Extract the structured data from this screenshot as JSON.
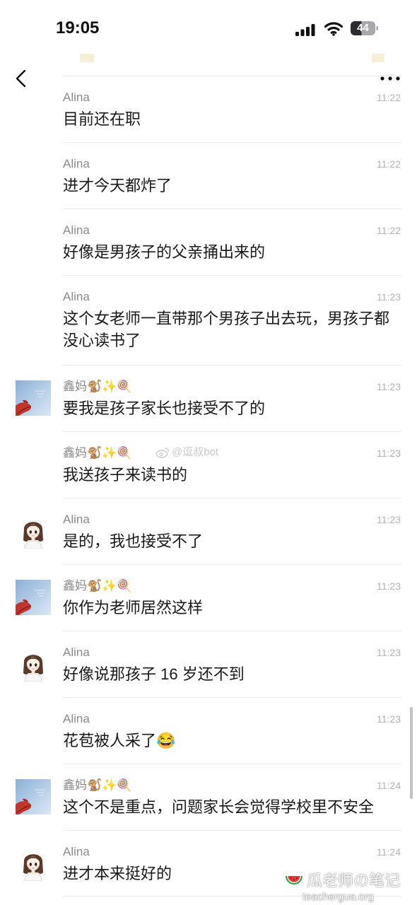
{
  "status_bar": {
    "time": "19:05",
    "battery": "44",
    "icons": [
      "signal-icon",
      "wifi-icon",
      "battery-icon"
    ]
  },
  "nav": {
    "back_icon": "chevron-left-icon",
    "more_icon": "more-icon"
  },
  "messages": [
    {
      "sender": "Alina",
      "time": "11:22",
      "text": "目前还在职",
      "avatar": null
    },
    {
      "sender": "Alina",
      "time": "11:22",
      "text": "进才今天都炸了",
      "avatar": null
    },
    {
      "sender": "Alina",
      "time": "11:22",
      "text": "好像是男孩子的父亲捅出来的",
      "avatar": null
    },
    {
      "sender": "Alina",
      "time": "11:23",
      "text": "这个女老师一直带那个男孩子出去玩，男孩子都没心读书了",
      "avatar": null
    },
    {
      "sender": "鑫妈🐒✨🍭",
      "time": "11:23",
      "text": "要我是孩子家长也接受不了的",
      "avatar": "xinma-avatar"
    },
    {
      "sender": "鑫妈🐒✨🍭",
      "time": "11:23",
      "text": "我送孩子来读书的",
      "avatar": null
    },
    {
      "sender": "Alina",
      "time": "11:23",
      "text": "是的，我也接受不了",
      "avatar": "alina-avatar"
    },
    {
      "sender": "鑫妈🐒✨🍭",
      "time": "11:23",
      "text": "你作为老师居然这样",
      "avatar": "xinma-avatar"
    },
    {
      "sender": "Alina",
      "time": "11:23",
      "text": "好像说那孩子 16 岁还不到",
      "avatar": "alina-avatar"
    },
    {
      "sender": "Alina",
      "time": "11:23",
      "text": "花苞被人采了😂",
      "avatar": null
    },
    {
      "sender": "鑫妈🐒✨🍭",
      "time": "11:24",
      "text": "这个不是重点，问题家长会觉得学校里不安全",
      "avatar": "xinma-avatar"
    },
    {
      "sender": "Alina",
      "time": "11:24",
      "text": "进才本来挺好的",
      "avatar": "alina-avatar"
    }
  ],
  "watermarks": {
    "weibo_icon": "weibo-logo-icon",
    "weibo": "@逗叔bot",
    "brand_icon": "watermelon-icon",
    "brand": "瓜老师の笔记",
    "site": "teachergua.org"
  }
}
